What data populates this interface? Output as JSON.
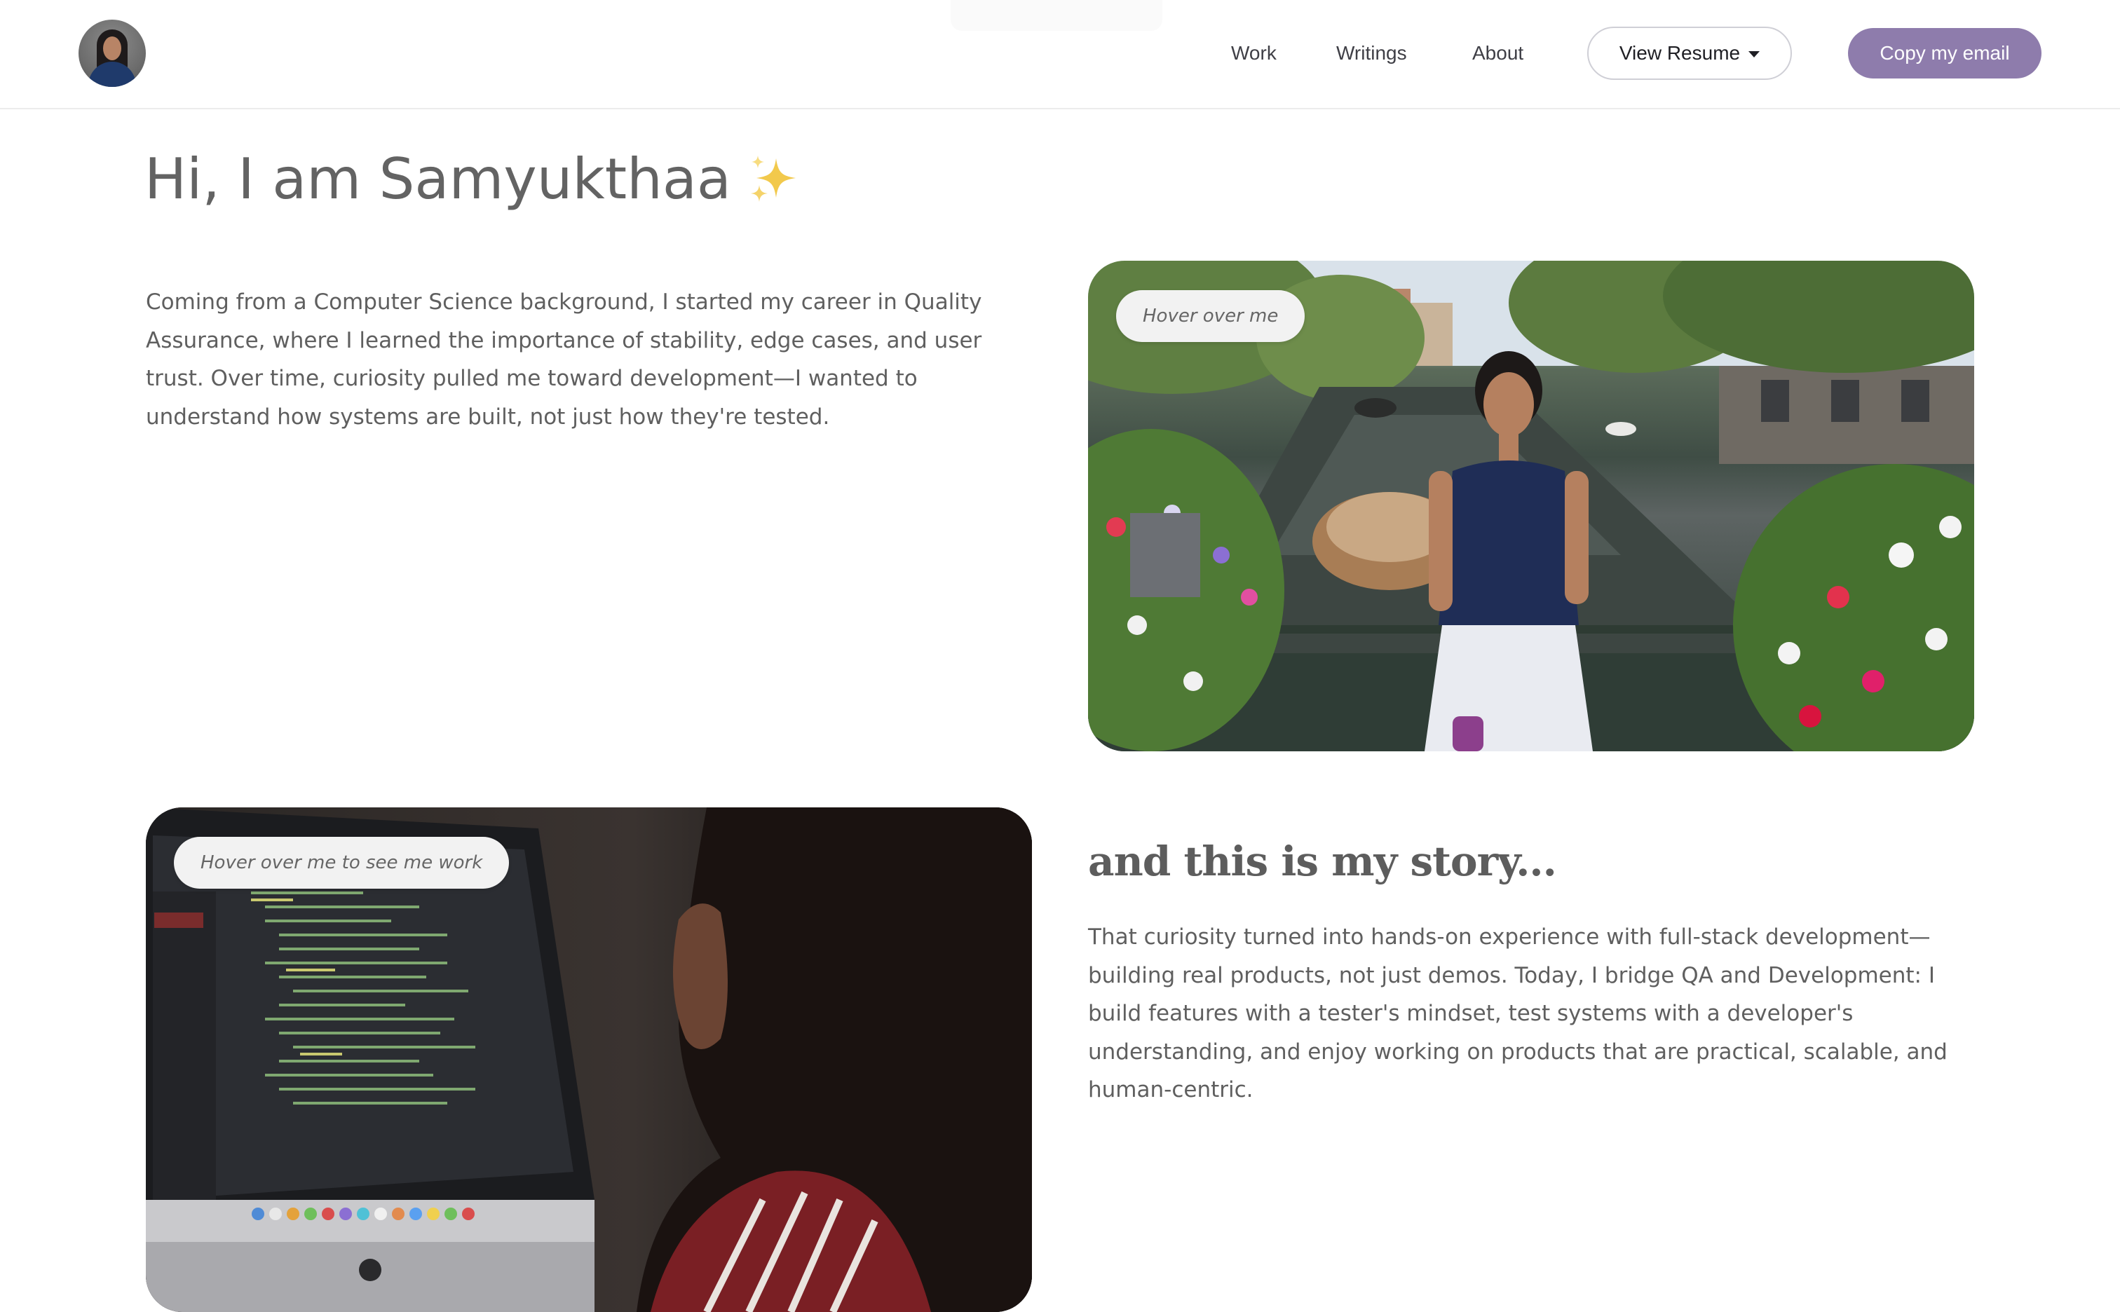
{
  "header": {
    "nav": [
      {
        "label": "Work"
      },
      {
        "label": "Writings"
      },
      {
        "label": "About"
      }
    ],
    "resume_button": {
      "label": "View Resume",
      "icon": "caret-down-icon"
    },
    "email_button": {
      "label": "Copy my email",
      "color": "#8e7cac"
    }
  },
  "hero": {
    "title": "Hi, I am Samyukthaa",
    "title_icon": "sparkles-icon",
    "intro": "Coming from a Computer Science background, I started my career in Quality Assurance, where I learned the importance of stability, edge cases, and user trust. Over time, curiosity pulled me toward development—I wanted to understand how systems are built, not just how they're tested.",
    "photo_tooltip": "Hover over me"
  },
  "story": {
    "heading": "and this is my story...",
    "text": "That curiosity turned into hands-on experience with full-stack development—building real products, not just demos. Today, I bridge QA and Development: I build features with a tester's mindset, test systems with a developer's understanding, and enjoy working on products that are practical, scalable, and human-centric.",
    "photo_tooltip": "Hover over me to see me work"
  },
  "colors": {
    "accent": "#8e7cac",
    "text": "#5f5f5f",
    "sparkle": "#f2c94c"
  }
}
